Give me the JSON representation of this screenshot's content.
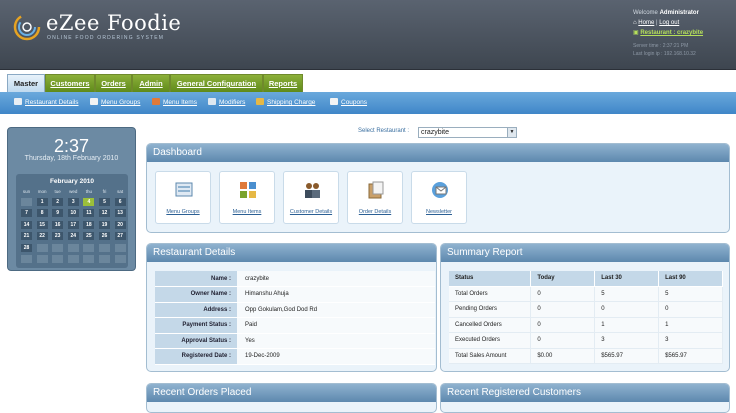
{
  "app": {
    "title": "eZee Foodie",
    "subtitle": "ONLINE FOOD ORDERING SYSTEM"
  },
  "user": {
    "welcome_prefix": "Welcome",
    "welcome_name": "Administrator",
    "home_link": "Home",
    "logout_link": "Log out",
    "separator": "|",
    "restaurant_link": "Restaurant : crazybite",
    "server_time": "Server time  :  2:37:21 PM",
    "last_login": "Last login ip  :  192.168.10.32"
  },
  "tabs": [
    {
      "label": "Master",
      "active": true
    },
    {
      "label": "Customers"
    },
    {
      "label": "Orders"
    },
    {
      "label": "Admin"
    },
    {
      "label": "General Configuration"
    },
    {
      "label": "Reports"
    }
  ],
  "subnav": [
    {
      "label": "Restaurant Details",
      "icon": "restaurant-icon"
    },
    {
      "label": "Menu Groups",
      "icon": "menu-groups-icon"
    },
    {
      "label": "Menu Items",
      "icon": "menu-items-icon"
    },
    {
      "label": "Modifiers",
      "icon": "modifiers-icon"
    },
    {
      "label": "Shipping Charge",
      "icon": "shipping-icon"
    },
    {
      "label": "Coupons",
      "icon": "coupon-icon"
    }
  ],
  "clock": {
    "time": "2:37",
    "date": "Thursday, 18th February 2010"
  },
  "calendar": {
    "month": "February 2010",
    "day_names": [
      "sun",
      "mon",
      "tue",
      "wed",
      "thu",
      "fri",
      "sat"
    ],
    "days": [
      "",
      "1",
      "2",
      "3",
      "4",
      "5",
      "6",
      "7",
      "8",
      "9",
      "10",
      "11",
      "12",
      "13",
      "14",
      "15",
      "16",
      "17",
      "18",
      "19",
      "20",
      "21",
      "22",
      "23",
      "24",
      "25",
      "26",
      "27",
      "28"
    ],
    "today": "4"
  },
  "restaurant_select": {
    "label": "Select Restaurant :",
    "value": "crazybite"
  },
  "dashboard": {
    "title": "Dashboard",
    "items": [
      {
        "label": "Menu Groups",
        "icon": "menu-groups-icon"
      },
      {
        "label": "Menu Items",
        "icon": "menu-items-icon"
      },
      {
        "label": "Customer Details",
        "icon": "customers-icon"
      },
      {
        "label": "Order Details",
        "icon": "orders-icon"
      },
      {
        "label": "Newsletter",
        "icon": "newsletter-icon"
      }
    ]
  },
  "restaurant_details": {
    "title": "Restaurant Details",
    "rows": [
      {
        "label": "Name :",
        "value": "crazybite"
      },
      {
        "label": "Owner Name :",
        "value": "Himanshu Ahuja"
      },
      {
        "label": "Address :",
        "value": "Opp Gokulam,God Dod Rd"
      },
      {
        "label": "Payment Status :",
        "value": "Paid"
      },
      {
        "label": "Approval Status :",
        "value": "Yes"
      },
      {
        "label": "Registered Date :",
        "value": "19-Dec-2009"
      }
    ]
  },
  "summary_report": {
    "title": "Summary Report",
    "columns": [
      "Status",
      "Today",
      "Last 30",
      "Last 90"
    ],
    "rows": [
      [
        "Total Orders",
        "0",
        "5",
        "5"
      ],
      [
        "Pending Orders",
        "0",
        "0",
        "0"
      ],
      [
        "Cancelled Orders",
        "0",
        "1",
        "1"
      ],
      [
        "Executed Orders",
        "0",
        "3",
        "3"
      ],
      [
        "Total Sales Amount",
        "$0.00",
        "$565.97",
        "$565.97"
      ]
    ]
  },
  "recent_orders": {
    "title": "Recent Orders Placed"
  },
  "recent_customers": {
    "title": "Recent Registered Customers"
  },
  "colors": {
    "header": "#4a525d",
    "tab_green": "#7aa32c",
    "subnav_blue": "#4a8fcf",
    "panel_head": "#7099bd",
    "today": "#9bbf3a"
  }
}
